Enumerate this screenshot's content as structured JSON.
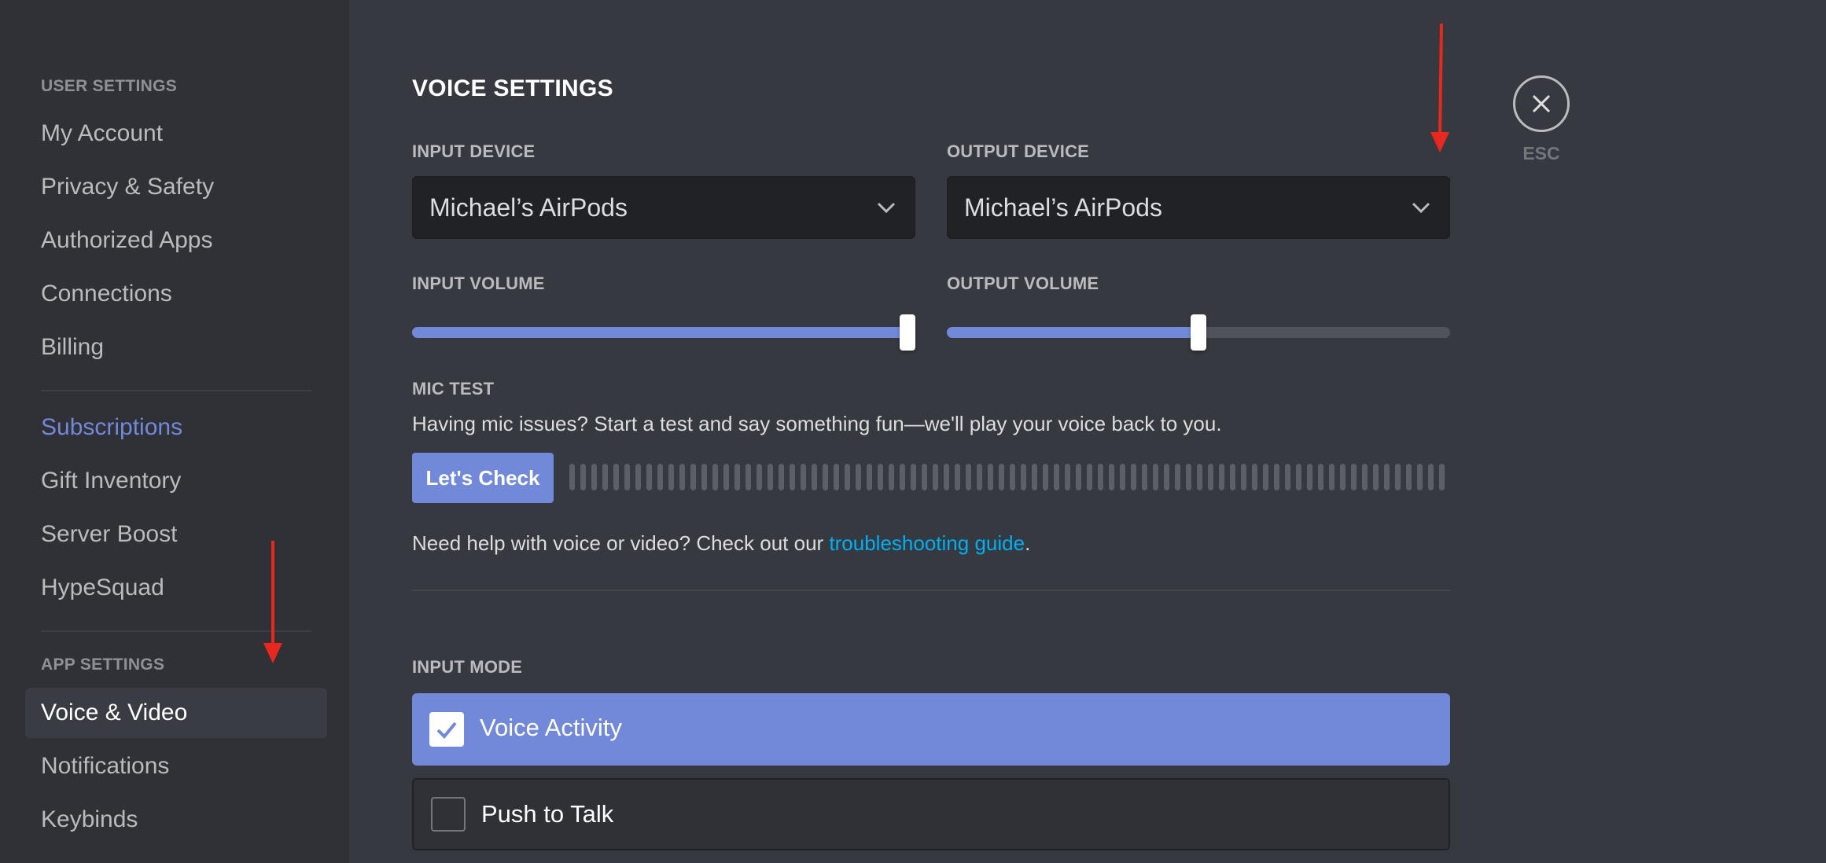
{
  "sidebar": {
    "user_settings_header": "USER SETTINGS",
    "user_items": [
      {
        "label": "My Account"
      },
      {
        "label": "Privacy & Safety"
      },
      {
        "label": "Authorized Apps"
      },
      {
        "label": "Connections"
      },
      {
        "label": "Billing"
      }
    ],
    "billing_items": [
      {
        "label": "Subscriptions"
      },
      {
        "label": "Gift Inventory"
      },
      {
        "label": "Server Boost"
      },
      {
        "label": "HypeSquad"
      }
    ],
    "app_settings_header": "APP SETTINGS",
    "app_items": [
      {
        "label": "Voice & Video"
      },
      {
        "label": "Notifications"
      },
      {
        "label": "Keybinds"
      }
    ]
  },
  "voice": {
    "title": "VOICE SETTINGS",
    "input_device_label": "INPUT DEVICE",
    "input_device_value": "Michael’s AirPods",
    "output_device_label": "OUTPUT DEVICE",
    "output_device_value": "Michael’s AirPods",
    "input_volume_label": "INPUT VOLUME",
    "input_volume_percent": 100,
    "output_volume_label": "OUTPUT VOLUME",
    "output_volume_percent": 50,
    "mic_test_label": "MIC TEST",
    "mic_test_desc": "Having mic issues? Start a test and say something fun—we'll play your voice back to you.",
    "lets_check_label": "Let's Check",
    "help_prefix": "Need help with voice or video? Check out our ",
    "help_link": "troubleshooting guide",
    "help_suffix": ".",
    "input_mode_label": "INPUT MODE",
    "modes": [
      {
        "label": "Voice Activity",
        "selected": true
      },
      {
        "label": "Push to Talk",
        "selected": false
      }
    ]
  },
  "close": {
    "esc_label": "ESC"
  },
  "colors": {
    "accent": "#7289da",
    "link": "#00b0f4",
    "annotation_arrow": "#e8281e"
  }
}
